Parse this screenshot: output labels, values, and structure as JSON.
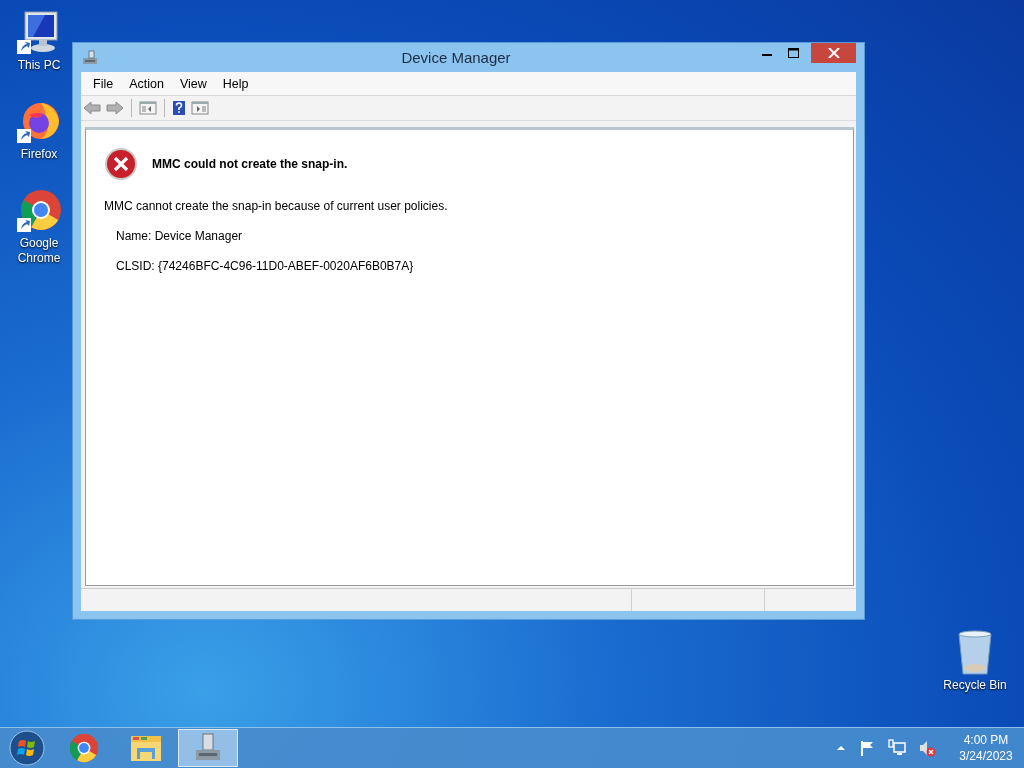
{
  "desktop_icons": [
    {
      "kind": "computer",
      "label": "This PC"
    },
    {
      "kind": "firefox",
      "label": "Firefox"
    },
    {
      "kind": "chrome",
      "label": "Google Chrome"
    }
  ],
  "recycle_bin": {
    "label": "Recycle Bin"
  },
  "window": {
    "title": "Device Manager"
  },
  "menu": [
    "File",
    "Action",
    "View",
    "Help"
  ],
  "error": {
    "heading": "MMC could not create the snap-in.",
    "message": "MMC cannot create the snap-in because of current user policies.",
    "details": [
      "Name: Device Manager",
      "CLSID: {74246BFC-4C96-11D0-ABEF-0020AF6B0B7A}"
    ]
  },
  "taskbar": {
    "apps": [
      {
        "kind": "chrome",
        "selected": false
      },
      {
        "kind": "explorer",
        "selected": false
      },
      {
        "kind": "device-manager",
        "selected": true
      }
    ]
  },
  "clock": {
    "time": "4:00 PM",
    "date": "3/24/2023"
  }
}
